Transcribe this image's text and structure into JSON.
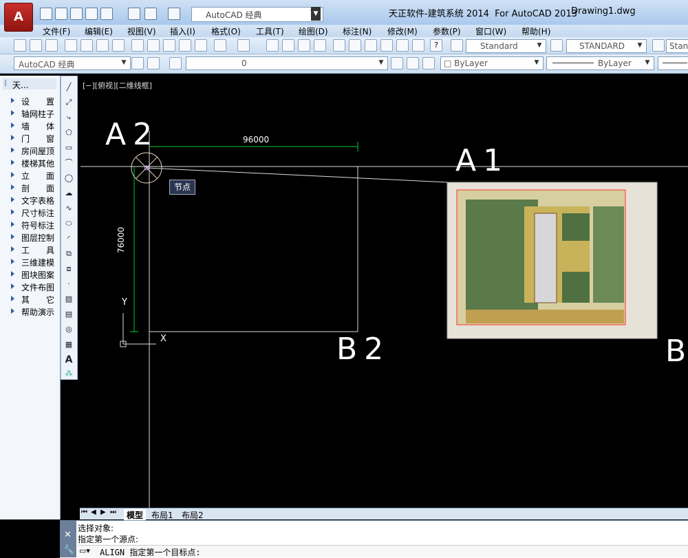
{
  "window": {
    "title": "天正软件-建筑系统 2014  For AutoCAD 2013",
    "document": "Drawing1.dwg",
    "workspace": "AutoCAD 经典",
    "logo_letter": "A"
  },
  "menu": [
    "文件(F)",
    "编辑(E)",
    "视图(V)",
    "插入(I)",
    "格式(O)",
    "工具(T)",
    "绘图(D)",
    "标注(N)",
    "修改(M)",
    "参数(P)",
    "窗口(W)",
    "帮助(H)"
  ],
  "toolbar": {
    "text_style": "Standard",
    "dim_style": "STANDARD",
    "table_style": "Stan",
    "workspace2": "AutoCAD 经典",
    "layer": "0",
    "color": "ByLayer",
    "linetype": "ByLayer"
  },
  "left_panel": {
    "title": "天...",
    "items": [
      "设　　置",
      "轴网柱子",
      "墙　　体",
      "门　　窗",
      "房间屋顶",
      "楼梯其他",
      "立　　面",
      "剖　　面",
      "文字表格",
      "尺寸标注",
      "符号标注",
      "图层控制",
      "工　　具",
      "三维建模",
      "图块图案",
      "文件布图",
      "其　　它",
      "帮助演示"
    ]
  },
  "draw_tools": [
    "line",
    "construction-line",
    "polyline",
    "polygon",
    "rectangle",
    "arc",
    "circle",
    "revision-cloud",
    "spline",
    "ellipse",
    "ellipse-arc",
    "insert-block",
    "make-block",
    "point",
    "hatch",
    "gradient",
    "region",
    "table",
    "multiline-text",
    "add-selected"
  ],
  "viewport": {
    "label": "[−][俯视][二维线框]",
    "dim_horizontal": "96000",
    "dim_vertical": "76000",
    "snap_tooltip": "节点",
    "point_labels": {
      "a2": "A2",
      "a1": "A1",
      "b2": "B2",
      "b1": "B"
    },
    "ucs_x": "X",
    "ucs_y": "Y",
    "colors": {
      "lines": "#ffffff",
      "dims": "#00cc33",
      "image_frame": "#ff3030",
      "snap": "#c8a0ff"
    }
  },
  "layout_tabs": [
    "模型",
    "布局1",
    "布局2"
  ],
  "command": {
    "line1": "选择对象:",
    "line2": "指定第一个源点:",
    "prompt": "ALIGN 指定第一个目标点:"
  }
}
